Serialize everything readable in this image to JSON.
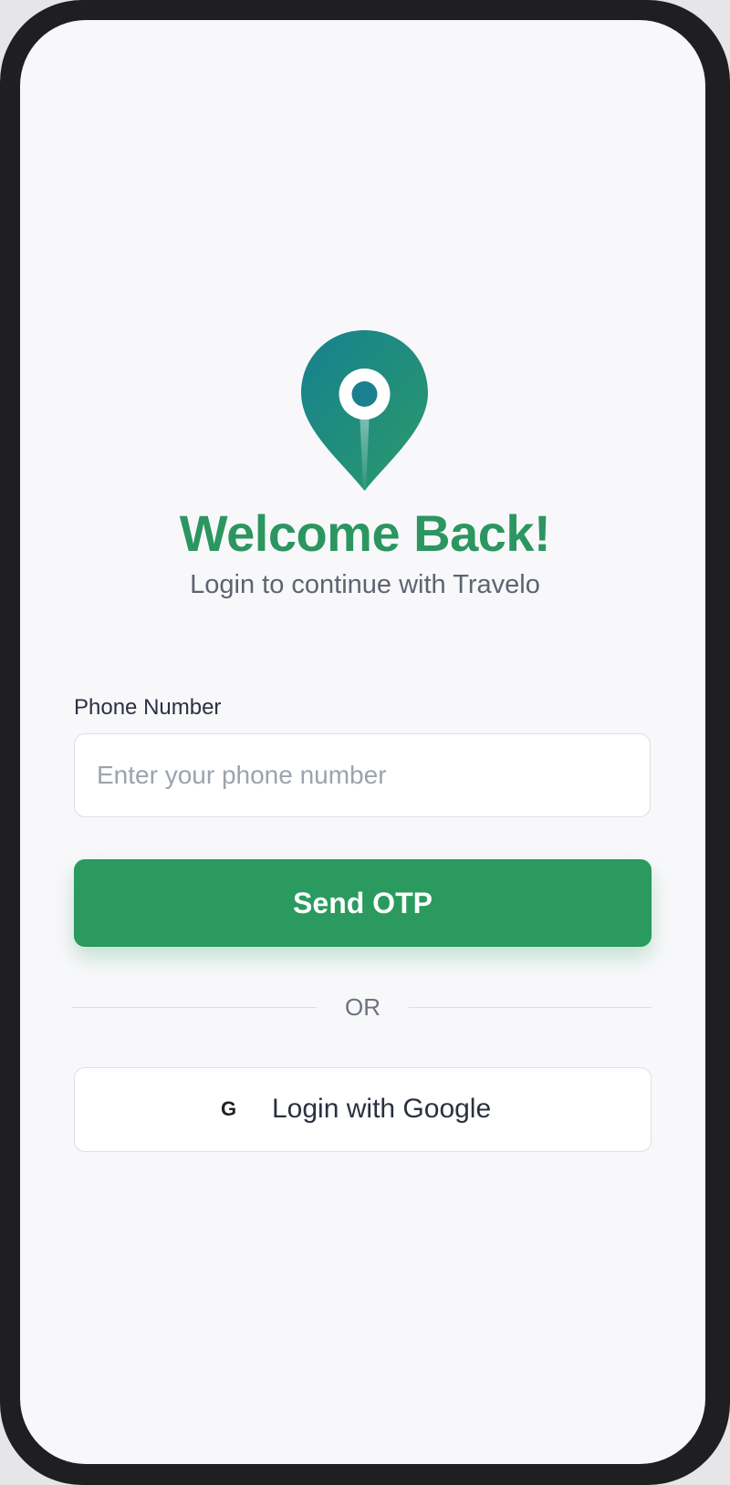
{
  "app": {
    "brand_color": "#2b9660",
    "accent_teal": "#1a7f8e"
  },
  "header": {
    "logo_icon": "map-pin-icon",
    "title": "Welcome Back!",
    "subtitle": "Login to continue with Travelo"
  },
  "form": {
    "phone_label": "Phone Number",
    "phone_placeholder": "Enter your phone number",
    "phone_value": "",
    "send_otp_label": "Send OTP"
  },
  "divider": {
    "text": "OR"
  },
  "google": {
    "icon_glyph": "G",
    "icon_name": "google-icon",
    "label": "Login with Google"
  }
}
